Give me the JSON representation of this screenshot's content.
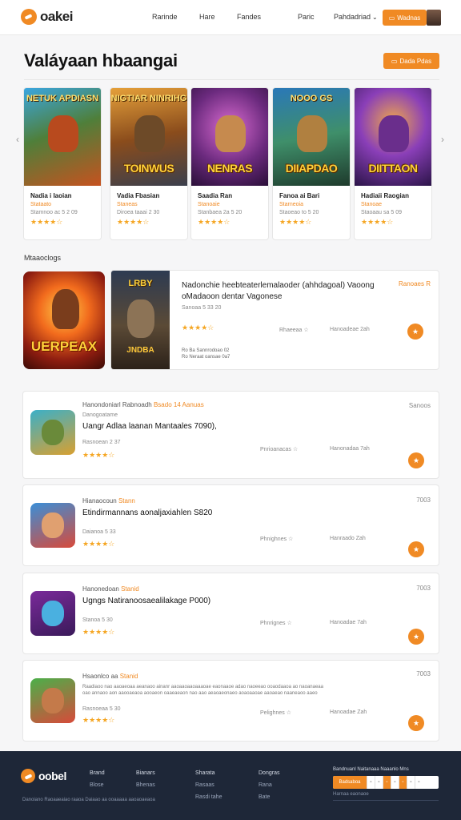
{
  "header": {
    "logo_text": "oakei",
    "nav": [
      "Rarinde",
      "Hare",
      "Fandes",
      "Paric"
    ],
    "nav_dropdown": "Pahdadriad",
    "cta_label": "Wadnas"
  },
  "page": {
    "title": "Valáyaan hbaangai",
    "action_label": "Dada Pdas"
  },
  "carousel": {
    "cards": [
      {
        "art_top": "NETUK APDIASN",
        "art_word": "",
        "name": "Nadia i Iaoian",
        "tag": "Stataato",
        "meta": "Stamnoo ac 5 2 09",
        "stars": "★★★★☆"
      },
      {
        "art_top": "NIGTIAR NINRIHG",
        "art_word": "TOINWUS",
        "name": "Vadia Fbasian",
        "tag": "Staneas",
        "meta": "Diroea taaai 2 30",
        "stars": "★★★★☆"
      },
      {
        "art_top": "",
        "art_word": "NENRAS",
        "name": "Saadia Ran",
        "tag": "Stanoaie",
        "meta": "Stanbaea 2a 5 20",
        "stars": "★★★★☆"
      },
      {
        "art_top": "NOOO GS",
        "art_word": "DIIAPDAO",
        "name": "Fanoa ai Bari",
        "tag": "Starneoia",
        "meta": "Staoeao to 5 20",
        "stars": "★★★★☆"
      },
      {
        "art_top": "",
        "art_word": "DIITTAON",
        "name": "Hadiaii Raogian",
        "tag": "Stanoae",
        "meta": "Staoaau sa 5 09",
        "stars": "★★★★☆"
      }
    ]
  },
  "featured": {
    "section_label": "Mtaaoclogs",
    "big_word": "UERPEAX",
    "thumb_top": "LRBY",
    "thumb_word": "JNDBA",
    "title": "Nadonchie heebteaterlemalaoder (ahhdagoal) Vaoong oMadaoon dentar Vagonese",
    "sub": "Sanoaa 5 33 20",
    "stars": "★★★★☆",
    "info_1": "Ro Ba Sannrodoao 02",
    "info_2": "Ro Neraat oansae 0a7",
    "badge": "Ranoaes R",
    "stat_1": "Rhaeeaa ☆",
    "stat_2": "Hanoadeae 2ah",
    "btn_icon": "★"
  },
  "list": [
    {
      "tag": "Hanondoniarl Rabnoadh",
      "tag_accent": "Bsado 14 Aanuas",
      "sub": "Danogoatame",
      "title": "Uangr Adlaa laanan Mantaales 7090),",
      "meta": "Rasnoean 2 37",
      "stars": "★★★★☆",
      "price": "Sanoos",
      "s1": "Pnrioanacas ☆",
      "s2": "Hanonadaa 7ah",
      "desc": ""
    },
    {
      "tag": "Hianaocoun",
      "tag_accent": "Stann",
      "sub": "",
      "title": "Etindirmannans aonaljaxiahlen S820",
      "meta": "Daianoa 5 33",
      "stars": "★★★★☆",
      "price": "7003",
      "s1": "Phnighnes ☆",
      "s2": "Hanraado Zah",
      "desc": ""
    },
    {
      "tag": "Hanonedoan",
      "tag_accent": "Stanid",
      "sub": "",
      "title": "Ugngs Natiranoosaealilakage P000)",
      "meta": "Stanoa 5 30",
      "stars": "★★★★☆",
      "price": "7003",
      "s1": "Phnrignes ☆",
      "s2": "Hanoadae 7ah",
      "desc": ""
    },
    {
      "tag": "Hsaonlco aa",
      "tag_accent": "Stanid",
      "sub": "",
      "title": "",
      "meta": "Rasnoeaa 5 30",
      "stars": "★★★★☆",
      "price": "7003",
      "s1": "Pelighnes ☆",
      "s2": "Hanoadae Zah",
      "desc": "Raadiaoo nao aaoaeoaa aeanaoo ainanr aaoaaoaaoaaaoae eaonaaoe adao naoeeao ooaodaaoa ao naoanaeaa oao annaoo aon aaooaeaoa aooaeon oaaeaeaon nao aao aeaoaeonaeo aoaoaaoae aaoaeao naaneaoo aaeo"
    }
  ],
  "footer": {
    "logo_text": "oobel",
    "copyright": "Danoiano Raoaaeaiao raaoa Daiaao aa ooaaaaa aaoaoaeaoa",
    "columns": [
      {
        "head": "Brand",
        "items": [
          "Blose",
          ""
        ]
      },
      {
        "head": "Bianars",
        "items": [
          "Bhenas",
          ""
        ]
      },
      {
        "head": "Sharata",
        "items": [
          "Rasaas",
          "Rasdi tahe"
        ]
      },
      {
        "head": "Dongras",
        "items": [
          "Rana",
          "Bate"
        ]
      }
    ],
    "newsletter_label": "Bandnuanl Naitanaaa Naaanlo Mns",
    "newsletter_btn": "Badsaboa",
    "newsletter_small": "Harnaa eaonaoe"
  }
}
